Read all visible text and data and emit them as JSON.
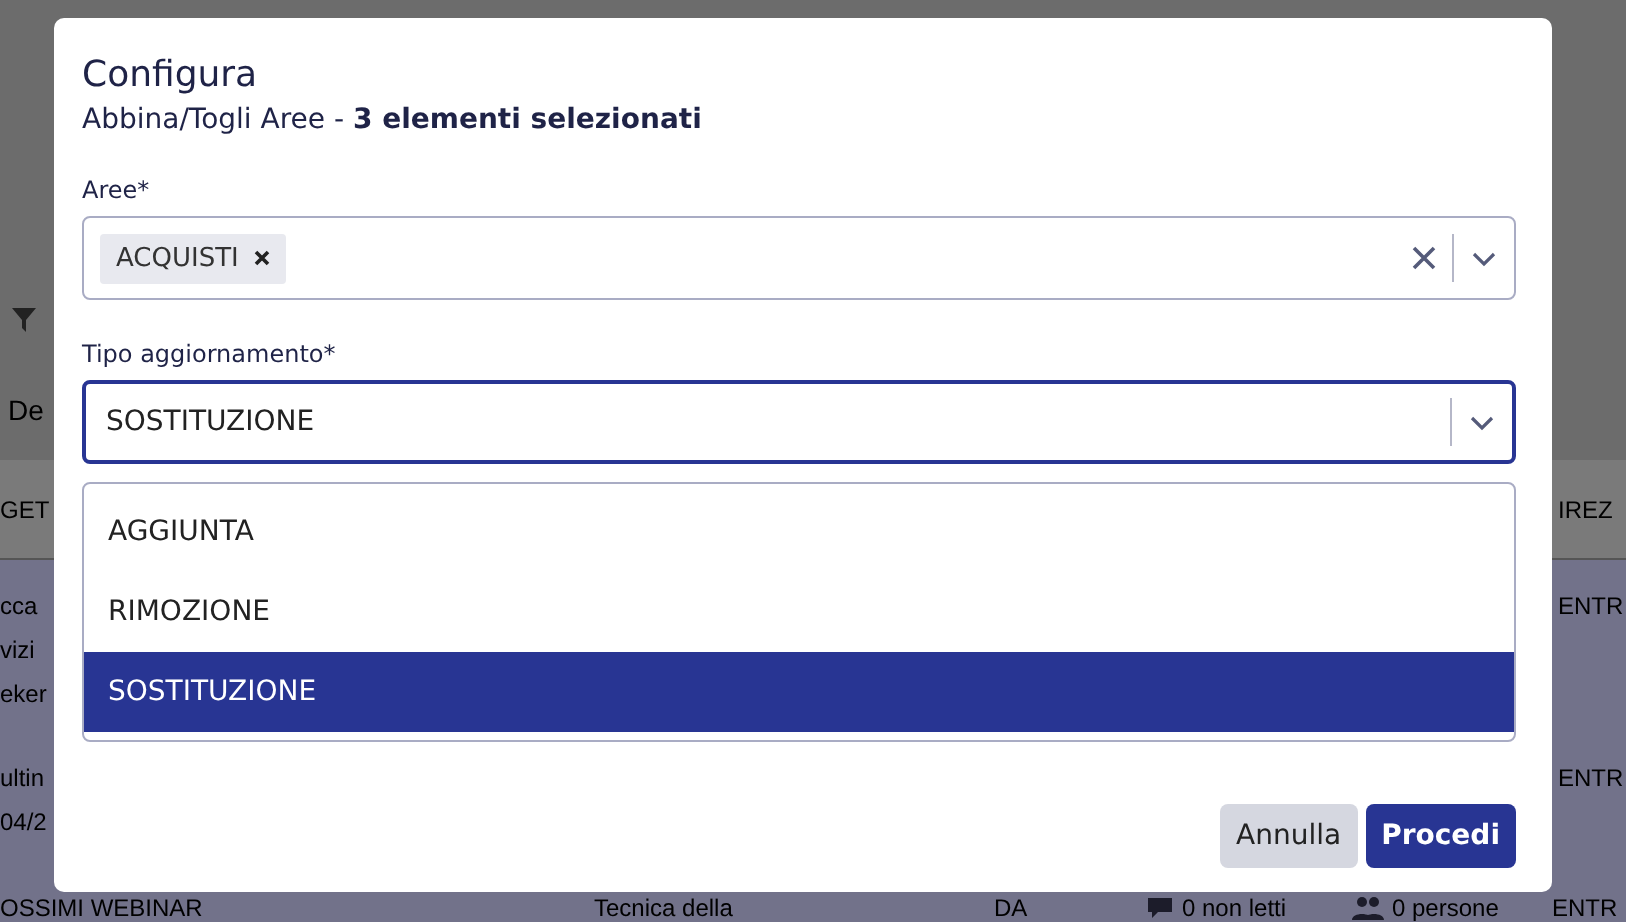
{
  "background_page": {
    "filter_label": "De",
    "header_left": "GET",
    "header_right": "IREZ",
    "rows": [
      {
        "left_lines": [
          "cca",
          "vizi",
          "eker"
        ],
        "right": "ENTR"
      },
      {
        "left_lines": [
          "ultin",
          "04/2"
        ],
        "right": "ENTR"
      }
    ],
    "last_row": {
      "title": "OSSIMI WEBINAR",
      "column_2": "Tecnica della",
      "column_3": "DA",
      "messages": "0 non letti",
      "people": "0 persone",
      "column_6": "ENTR"
    }
  },
  "dialog": {
    "title": "Configura",
    "subtitle": "Abbina/Togli Aree - **3 elementi selezionati**",
    "areas_field": {
      "label": "Aree*",
      "tags": [
        {
          "label": "ACQUISTI"
        }
      ]
    },
    "update_type_field": {
      "label": "Tipo aggiornamento*",
      "value": "SOSTITUZIONE",
      "expanded": true,
      "options": [
        {
          "label": "AGGIUNTA",
          "selected": false
        },
        {
          "label": "RIMOZIONE",
          "selected": false
        },
        {
          "label": "SOSTITUZIONE",
          "selected": true
        }
      ]
    },
    "buttons": [
      {
        "label": "Annulla",
        "kind": "secondary"
      },
      {
        "label": "Procedi",
        "kind": "primary"
      }
    ]
  }
}
